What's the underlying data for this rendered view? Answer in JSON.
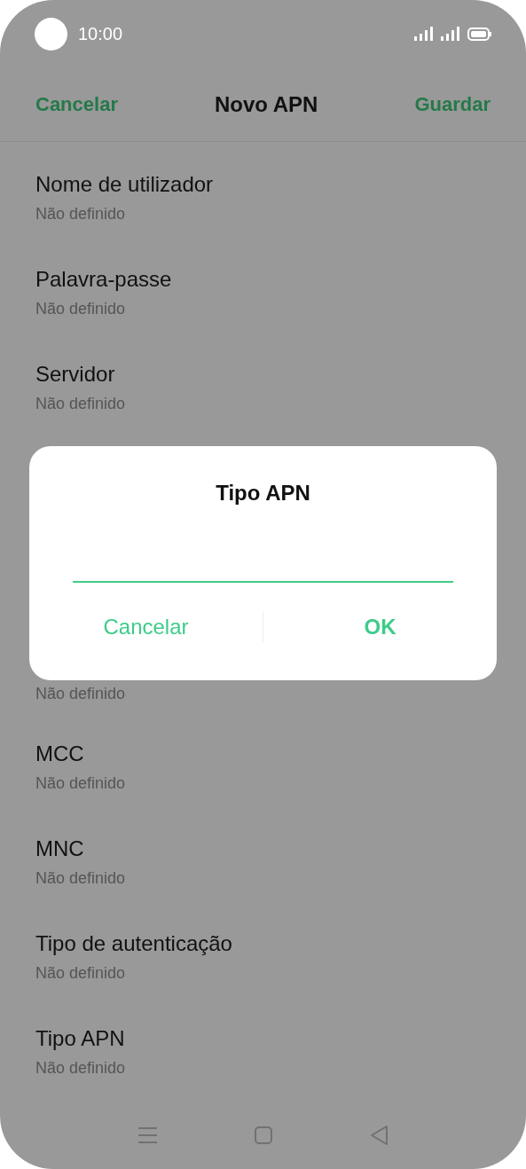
{
  "status_bar": {
    "time": "10:00"
  },
  "header": {
    "cancel": "Cancelar",
    "title": "Novo APN",
    "save": "Guardar"
  },
  "settings": [
    {
      "label": "Nome de utilizador",
      "value": "Não definido"
    },
    {
      "label": "Palavra-passe",
      "value": "Não definido"
    },
    {
      "label": "Servidor",
      "value": "Não definido"
    },
    {
      "value": "Não definido"
    },
    {
      "label": "MCC",
      "value": "Não definido"
    },
    {
      "label": "MNC",
      "value": "Não definido"
    },
    {
      "label": "Tipo de autenticação",
      "value": "Não definido"
    },
    {
      "label": "Tipo APN",
      "value": "Não definido"
    }
  ],
  "dialog": {
    "title": "Tipo APN",
    "buttons": [
      {
        "label": "Cancelar",
        "kind": "secondary"
      },
      {
        "label": "OK",
        "kind": "primary"
      }
    ]
  }
}
